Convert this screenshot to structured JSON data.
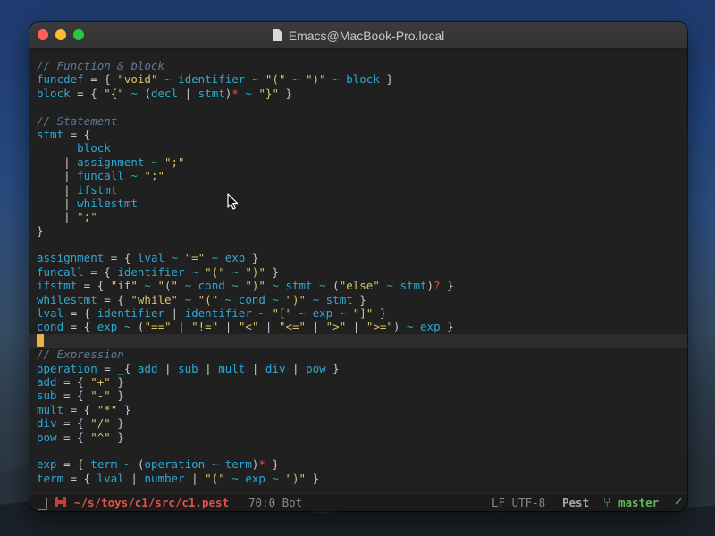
{
  "window": {
    "title": "Emacs@MacBook-Pro.local"
  },
  "buffer": {
    "lines": [
      [
        {
          "t": "// Function & block",
          "c": "comment"
        }
      ],
      [
        {
          "t": "funcdef",
          "c": "var"
        },
        {
          "t": " = { ",
          "c": "punct"
        },
        {
          "t": "\"void\"",
          "c": "str"
        },
        {
          "t": " ~ ",
          "c": "op"
        },
        {
          "t": "identifier",
          "c": "var"
        },
        {
          "t": " ~ ",
          "c": "op"
        },
        {
          "t": "\"(\"",
          "c": "str"
        },
        {
          "t": " ~ ",
          "c": "op"
        },
        {
          "t": "\")\"",
          "c": "str"
        },
        {
          "t": " ~ ",
          "c": "op"
        },
        {
          "t": "block",
          "c": "var"
        },
        {
          "t": " }",
          "c": "punct"
        }
      ],
      [
        {
          "t": "block",
          "c": "var"
        },
        {
          "t": " = { ",
          "c": "punct"
        },
        {
          "t": "\"{\"",
          "c": "str"
        },
        {
          "t": " ~ ",
          "c": "op"
        },
        {
          "t": "(",
          "c": "punct"
        },
        {
          "t": "decl",
          "c": "var"
        },
        {
          "t": " | ",
          "c": "punct"
        },
        {
          "t": "stmt",
          "c": "var"
        },
        {
          "t": ")",
          "c": "punct"
        },
        {
          "t": "*",
          "c": "star"
        },
        {
          "t": " ~ ",
          "c": "op"
        },
        {
          "t": "\"}\"",
          "c": "str"
        },
        {
          "t": " }",
          "c": "punct"
        }
      ],
      [],
      [
        {
          "t": "// Statement",
          "c": "comment"
        }
      ],
      [
        {
          "t": "stmt",
          "c": "var"
        },
        {
          "t": " = {",
          "c": "punct"
        }
      ],
      [
        {
          "t": "      ",
          "c": "punct"
        },
        {
          "t": "block",
          "c": "var"
        }
      ],
      [
        {
          "t": "    | ",
          "c": "punct"
        },
        {
          "t": "assignment",
          "c": "var"
        },
        {
          "t": " ~ ",
          "c": "op"
        },
        {
          "t": "\";\"",
          "c": "str"
        }
      ],
      [
        {
          "t": "    | ",
          "c": "punct"
        },
        {
          "t": "funcall",
          "c": "var"
        },
        {
          "t": " ~ ",
          "c": "op"
        },
        {
          "t": "\";\"",
          "c": "str"
        }
      ],
      [
        {
          "t": "    | ",
          "c": "punct"
        },
        {
          "t": "ifstmt",
          "c": "var"
        }
      ],
      [
        {
          "t": "    | ",
          "c": "punct"
        },
        {
          "t": "whilestmt",
          "c": "var"
        }
      ],
      [
        {
          "t": "    | ",
          "c": "punct"
        },
        {
          "t": "\";\"",
          "c": "str"
        }
      ],
      [
        {
          "t": "}",
          "c": "punct"
        }
      ],
      [],
      [
        {
          "t": "assignment",
          "c": "var"
        },
        {
          "t": " = { ",
          "c": "punct"
        },
        {
          "t": "lval",
          "c": "var"
        },
        {
          "t": " ~ ",
          "c": "op"
        },
        {
          "t": "\"=\"",
          "c": "str"
        },
        {
          "t": " ~ ",
          "c": "op"
        },
        {
          "t": "exp",
          "c": "var"
        },
        {
          "t": " }",
          "c": "punct"
        }
      ],
      [
        {
          "t": "funcall",
          "c": "var"
        },
        {
          "t": " = { ",
          "c": "punct"
        },
        {
          "t": "identifier",
          "c": "var"
        },
        {
          "t": " ~ ",
          "c": "op"
        },
        {
          "t": "\"(\"",
          "c": "str"
        },
        {
          "t": " ~ ",
          "c": "op"
        },
        {
          "t": "\")\"",
          "c": "str"
        },
        {
          "t": " }",
          "c": "punct"
        }
      ],
      [
        {
          "t": "ifstmt",
          "c": "var"
        },
        {
          "t": " = { ",
          "c": "punct"
        },
        {
          "t": "\"if\"",
          "c": "str"
        },
        {
          "t": " ~ ",
          "c": "op"
        },
        {
          "t": "\"(\"",
          "c": "str"
        },
        {
          "t": " ~ ",
          "c": "op"
        },
        {
          "t": "cond",
          "c": "var"
        },
        {
          "t": " ~ ",
          "c": "op"
        },
        {
          "t": "\")\"",
          "c": "str"
        },
        {
          "t": " ~ ",
          "c": "op"
        },
        {
          "t": "stmt",
          "c": "var"
        },
        {
          "t": " ~ ",
          "c": "op"
        },
        {
          "t": "(",
          "c": "punct"
        },
        {
          "t": "\"else\"",
          "c": "str"
        },
        {
          "t": " ~ ",
          "c": "op"
        },
        {
          "t": "stmt",
          "c": "var"
        },
        {
          "t": ")",
          "c": "punct"
        },
        {
          "t": "?",
          "c": "star"
        },
        {
          "t": " }",
          "c": "punct"
        }
      ],
      [
        {
          "t": "whilestmt",
          "c": "var"
        },
        {
          "t": " = { ",
          "c": "punct"
        },
        {
          "t": "\"while\"",
          "c": "str"
        },
        {
          "t": " ~ ",
          "c": "op"
        },
        {
          "t": "\"(\"",
          "c": "str"
        },
        {
          "t": " ~ ",
          "c": "op"
        },
        {
          "t": "cond",
          "c": "var"
        },
        {
          "t": " ~ ",
          "c": "op"
        },
        {
          "t": "\")\"",
          "c": "str"
        },
        {
          "t": " ~ ",
          "c": "op"
        },
        {
          "t": "stmt",
          "c": "var"
        },
        {
          "t": " }",
          "c": "punct"
        }
      ],
      [
        {
          "t": "lval",
          "c": "var"
        },
        {
          "t": " = { ",
          "c": "punct"
        },
        {
          "t": "identifier",
          "c": "var"
        },
        {
          "t": " | ",
          "c": "punct"
        },
        {
          "t": "identifier",
          "c": "var"
        },
        {
          "t": " ~ ",
          "c": "op"
        },
        {
          "t": "\"[\"",
          "c": "str"
        },
        {
          "t": " ~ ",
          "c": "op"
        },
        {
          "t": "exp",
          "c": "var"
        },
        {
          "t": " ~ ",
          "c": "op"
        },
        {
          "t": "\"]\"",
          "c": "str"
        },
        {
          "t": " }",
          "c": "punct"
        }
      ],
      [
        {
          "t": "cond",
          "c": "var"
        },
        {
          "t": " = { ",
          "c": "punct"
        },
        {
          "t": "exp",
          "c": "var"
        },
        {
          "t": " ~ ",
          "c": "op"
        },
        {
          "t": "(",
          "c": "punct"
        },
        {
          "t": "\"==\"",
          "c": "str"
        },
        {
          "t": " | ",
          "c": "punct"
        },
        {
          "t": "\"!=\"",
          "c": "str"
        },
        {
          "t": " | ",
          "c": "punct"
        },
        {
          "t": "\"<\"",
          "c": "str"
        },
        {
          "t": " | ",
          "c": "punct"
        },
        {
          "t": "\"<=\"",
          "c": "str"
        },
        {
          "t": " | ",
          "c": "punct"
        },
        {
          "t": "\">\"",
          "c": "str"
        },
        {
          "t": " | ",
          "c": "punct"
        },
        {
          "t": "\">=\"",
          "c": "str"
        },
        {
          "t": ")",
          "c": "punct"
        },
        {
          "t": " ~ ",
          "c": "op"
        },
        {
          "t": "exp",
          "c": "var"
        },
        {
          "t": " }",
          "c": "punct"
        }
      ],
      [
        {
          "cursor": true
        }
      ],
      [
        {
          "t": "// Expression",
          "c": "comment"
        }
      ],
      [
        {
          "t": "operation",
          "c": "var"
        },
        {
          "t": " = ",
          "c": "punct"
        },
        {
          "t": "_",
          "c": "under"
        },
        {
          "t": "{ ",
          "c": "punct"
        },
        {
          "t": "add",
          "c": "var"
        },
        {
          "t": " | ",
          "c": "punct"
        },
        {
          "t": "sub",
          "c": "var"
        },
        {
          "t": " | ",
          "c": "punct"
        },
        {
          "t": "mult",
          "c": "var"
        },
        {
          "t": " | ",
          "c": "punct"
        },
        {
          "t": "div",
          "c": "var"
        },
        {
          "t": " | ",
          "c": "punct"
        },
        {
          "t": "pow",
          "c": "var"
        },
        {
          "t": " }",
          "c": "punct"
        }
      ],
      [
        {
          "t": "add",
          "c": "var"
        },
        {
          "t": " = { ",
          "c": "punct"
        },
        {
          "t": "\"+\"",
          "c": "str"
        },
        {
          "t": " }",
          "c": "punct"
        }
      ],
      [
        {
          "t": "sub",
          "c": "var"
        },
        {
          "t": " = { ",
          "c": "punct"
        },
        {
          "t": "\"-\"",
          "c": "str"
        },
        {
          "t": " }",
          "c": "punct"
        }
      ],
      [
        {
          "t": "mult",
          "c": "var"
        },
        {
          "t": " = { ",
          "c": "punct"
        },
        {
          "t": "\"*\"",
          "c": "str"
        },
        {
          "t": " }",
          "c": "punct"
        }
      ],
      [
        {
          "t": "div",
          "c": "var"
        },
        {
          "t": " = { ",
          "c": "punct"
        },
        {
          "t": "\"/\"",
          "c": "str"
        },
        {
          "t": " }",
          "c": "punct"
        }
      ],
      [
        {
          "t": "pow",
          "c": "var"
        },
        {
          "t": " = { ",
          "c": "punct"
        },
        {
          "t": "\"^\"",
          "c": "str"
        },
        {
          "t": " }",
          "c": "punct"
        }
      ],
      [],
      [
        {
          "t": "exp",
          "c": "var"
        },
        {
          "t": " = { ",
          "c": "punct"
        },
        {
          "t": "term",
          "c": "var"
        },
        {
          "t": " ~ ",
          "c": "op"
        },
        {
          "t": "(",
          "c": "punct"
        },
        {
          "t": "operation",
          "c": "var"
        },
        {
          "t": " ~ ",
          "c": "op"
        },
        {
          "t": "term",
          "c": "var"
        },
        {
          "t": ")",
          "c": "punct"
        },
        {
          "t": "*",
          "c": "star"
        },
        {
          "t": " }",
          "c": "punct"
        }
      ],
      [
        {
          "t": "term",
          "c": "var"
        },
        {
          "t": " = { ",
          "c": "punct"
        },
        {
          "t": "lval",
          "c": "var"
        },
        {
          "t": " | ",
          "c": "punct"
        },
        {
          "t": "number",
          "c": "var"
        },
        {
          "t": " | ",
          "c": "punct"
        },
        {
          "t": "\"(\"",
          "c": "str"
        },
        {
          "t": " ~ ",
          "c": "op"
        },
        {
          "t": "exp",
          "c": "var"
        },
        {
          "t": " ~ ",
          "c": "op"
        },
        {
          "t": "\")\"",
          "c": "str"
        },
        {
          "t": " }",
          "c": "punct"
        }
      ]
    ]
  },
  "modeline": {
    "path": "~/s/toys/c1/src/c1.pest",
    "position": "70:0 Bot",
    "encoding": "LF UTF-8",
    "major_mode": "Pest",
    "branch": "master",
    "status_icon": "check-icon",
    "modified_icon": "floppy-disk-icon"
  },
  "colors": {
    "variable": "#2ea8d3",
    "string": "#d7c46a",
    "operator": "#2bb3a8",
    "comment": "#5f7a96",
    "modifier": "#e2513f",
    "cursor": "#e8b34a",
    "path": "#e0534a",
    "branch": "#5fb85f"
  }
}
